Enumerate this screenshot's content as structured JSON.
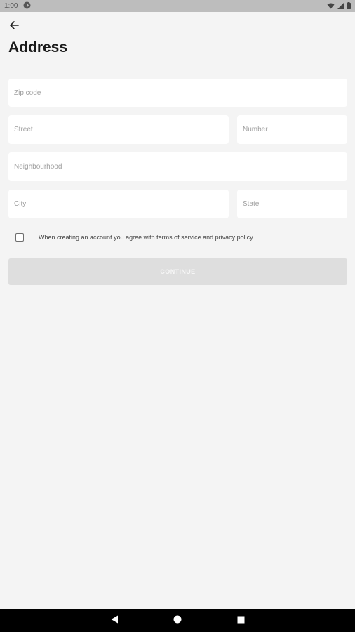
{
  "status_bar": {
    "time": "1:00",
    "icons": [
      "app-notification-icon",
      "wifi-icon",
      "signal-icon",
      "battery-icon"
    ]
  },
  "header": {
    "back_icon": "arrow-left-icon",
    "title": "Address"
  },
  "form": {
    "zip_code_placeholder": "Zip code",
    "street_placeholder": "Street",
    "number_placeholder": "Number",
    "neighbourhood_placeholder": "Neighbourhood",
    "city_placeholder": "City",
    "state_placeholder": "State",
    "terms_checked": false,
    "terms_label": "When creating an account you agree with terms of service and privacy policy.",
    "continue_label": "CONTINUE"
  },
  "nav_bar": {
    "icons": [
      "back-triangle-icon",
      "home-circle-icon",
      "recents-square-icon"
    ]
  },
  "colors": {
    "background": "#f4f4f4",
    "field_background": "#ffffff",
    "button_disabled": "#dedede",
    "status_bar": "#bdbdbd",
    "nav_bar": "#000000"
  }
}
